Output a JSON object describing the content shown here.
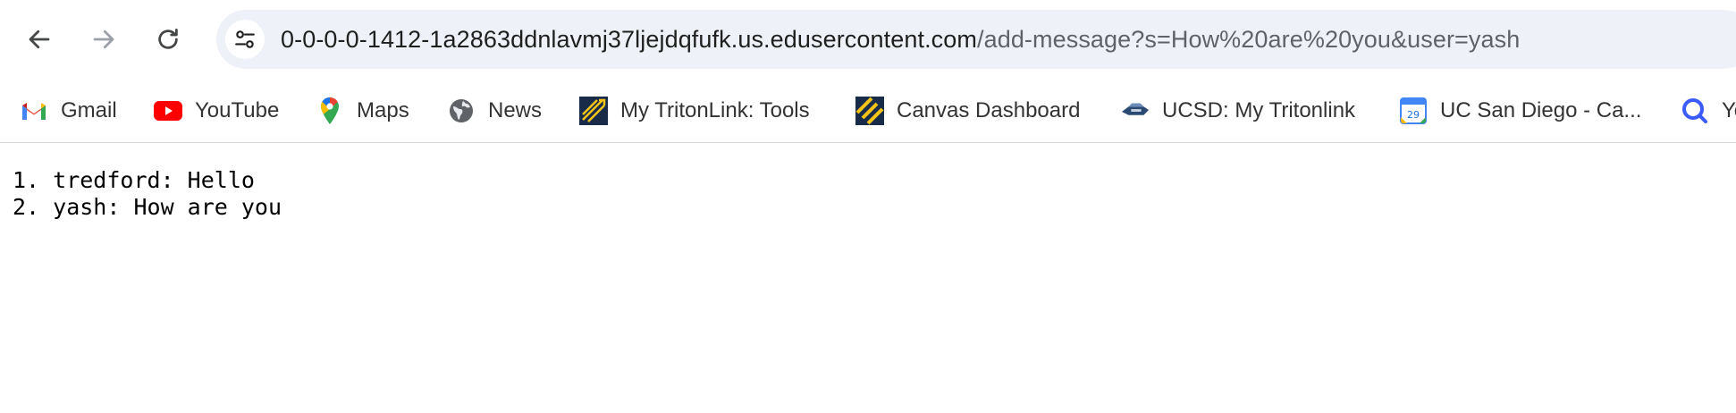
{
  "browser": {
    "url_host": "0-0-0-0-1412-1a2863ddnlavmj37ljejdqfufk.us.edusercontent.com",
    "url_path": "/add-message?s=How%20are%20you&user=yash"
  },
  "bookmarks": [
    {
      "label": "Gmail",
      "icon": "gmail-icon"
    },
    {
      "label": "YouTube",
      "icon": "youtube-icon"
    },
    {
      "label": "Maps",
      "icon": "maps-icon"
    },
    {
      "label": "News",
      "icon": "news-icon"
    },
    {
      "label": "My TritonLink: Tools",
      "icon": "tritonlink-icon"
    },
    {
      "label": "Canvas Dashboard",
      "icon": "canvas-icon"
    },
    {
      "label": "UCSD: My Tritonlink",
      "icon": "ucsd-icon"
    },
    {
      "label": "UC San Diego - Ca...",
      "icon": "calendar-icon"
    },
    {
      "label": "Yo",
      "icon": "search-icon"
    }
  ],
  "messages": [
    "1. tredford: Hello",
    "2. yash: How are you"
  ],
  "colors": {
    "omnibox_bg": "#eef1f7",
    "text": "#1f1f1f",
    "muted": "#5f6368"
  }
}
